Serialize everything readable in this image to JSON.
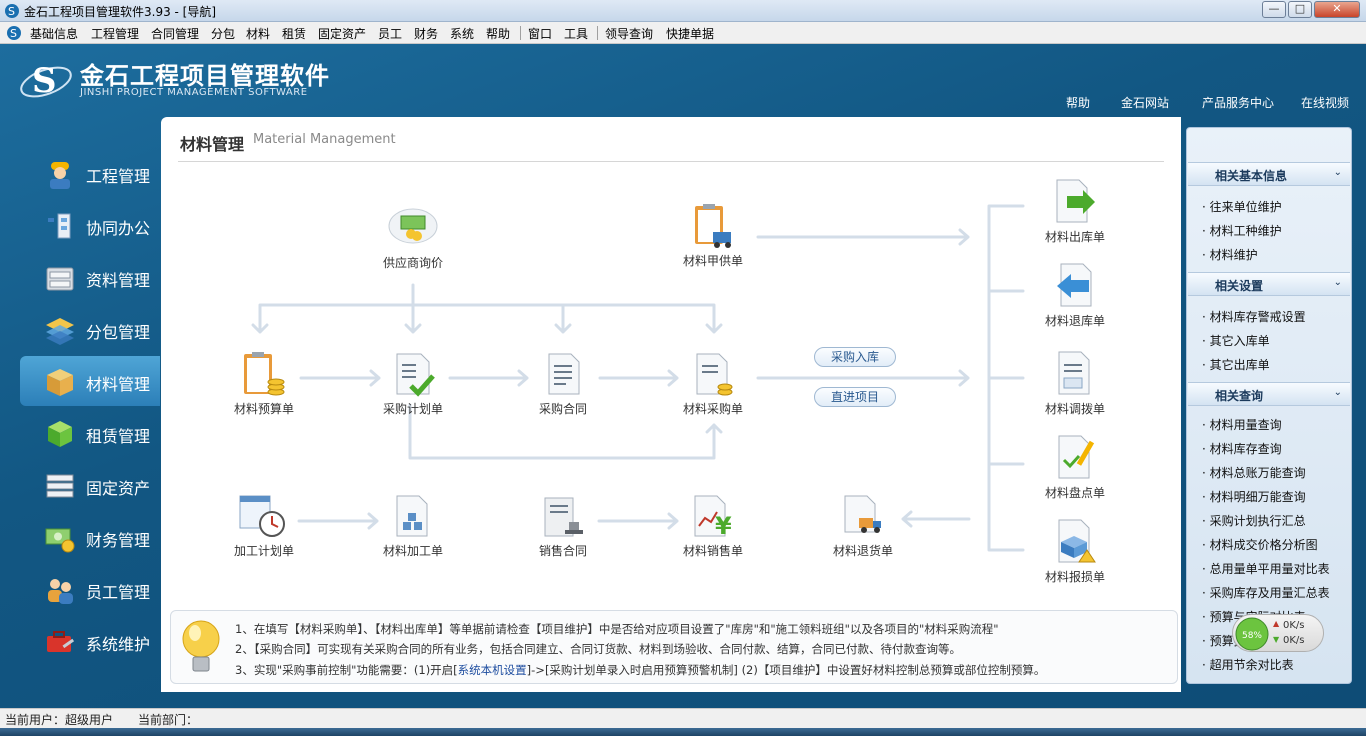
{
  "window": {
    "title": "金石工程项目管理软件3.93 - [导航]",
    "minimize": "—",
    "maximize": "□",
    "close": "✕"
  },
  "menu": [
    "基础信息",
    "工程管理",
    "合同管理",
    "分包",
    "材料",
    "租赁",
    "固定资产",
    "员工",
    "财务",
    "系统",
    "帮助",
    "窗口",
    "工具",
    "领导查询",
    "快捷单据"
  ],
  "brand": {
    "name_cn": "金石工程项目管理软件",
    "name_en": "JINSHI PROJECT MANAGEMENT SOFTWARE"
  },
  "top_links": [
    "帮助",
    "金石网站",
    "产品服务中心",
    "在线视频"
  ],
  "nav": [
    {
      "label": "工程管理",
      "icon": "worker-icon"
    },
    {
      "label": "协同办公",
      "icon": "collaboration-icon"
    },
    {
      "label": "资料管理",
      "icon": "file-cabinet-icon"
    },
    {
      "label": "分包管理",
      "icon": "layers-icon"
    },
    {
      "label": "材料管理",
      "icon": "box-icon",
      "active": true
    },
    {
      "label": "租赁管理",
      "icon": "cubes-icon"
    },
    {
      "label": "固定资产",
      "icon": "server-rack-icon"
    },
    {
      "label": "财务管理",
      "icon": "money-icon"
    },
    {
      "label": "员工管理",
      "icon": "people-icon"
    },
    {
      "label": "系统维护",
      "icon": "toolbox-icon"
    }
  ],
  "content": {
    "title": "材料管理",
    "subtitle": "Material Management"
  },
  "flow": {
    "supplier_quote": "供应商询价",
    "buyer_supply": "材料甲供单",
    "budget": "材料预算单",
    "purchase_plan": "采购计划单",
    "purchase_contract": "采购合同",
    "material_purchase": "材料采购单",
    "pill_in": "采购入库",
    "pill_direct": "直进项目",
    "process_plan": "加工计划单",
    "material_process": "材料加工单",
    "sales_contract": "销售合同",
    "material_sales": "材料销售单",
    "material_return": "材料退货单",
    "outbound": "材料出库单",
    "return_stock": "材料退库单",
    "transfer": "材料调拨单",
    "inventory": "材料盘点单",
    "damage": "材料报损单"
  },
  "tips": {
    "line1": "1、在填写【材料采购单】、【材料出库单】等单据前请检查【项目维护】中是否给对应项目设置了\"库房\"和\"施工领料班组\"以及各项目的\"材料采购流程\"",
    "line2": "2、【采购合同】可实现有关采购合同的所有业务，包括合同建立、合同订货款、材料到场验收、合同付款、结算，合同已付款、待付款查询等。",
    "line3_a": "3、实现\"采购事前控制\"功能需要：(1)开启[",
    "line3_link": "系统本机设置",
    "line3_b": "]->[采购计划单录入时启用预算预警机制] (2)【项目维护】中设置好材料控制总预算或部位控制预算。"
  },
  "side": {
    "sections": [
      {
        "title": "相关基本信息",
        "items": [
          "往来单位维护",
          "材料工种维护",
          "材料维护"
        ]
      },
      {
        "title": "相关设置",
        "items": [
          "材料库存警戒设置",
          "其它入库单",
          "其它出库单"
        ]
      },
      {
        "title": "相关查询",
        "items": [
          "材料用量查询",
          "材料库存查询",
          "材料总账万能查询",
          "材料明细万能查询",
          "采购计划执行汇总",
          "材料成交价格分析图",
          "总用量单平用量对比表",
          "采购库存及用量汇总表",
          "预算与实际对比表",
          "预算执行汇总表",
          "超用节余对比表"
        ]
      }
    ],
    "chevron": "⌄"
  },
  "net": {
    "percent": "58%",
    "up": "0K/s",
    "down": "0K/s"
  },
  "status": {
    "user_label": "当前用户：超级用户",
    "dept_label": "当前部门："
  },
  "colors": {
    "brand_blue": "#125783",
    "nav_active": "#3a8fc4",
    "arrow": "#d3dde8"
  }
}
